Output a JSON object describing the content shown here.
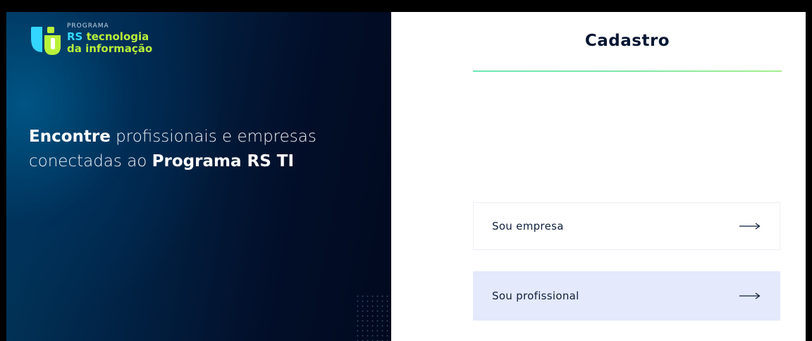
{
  "brand": {
    "program_label": "PROGRAMA",
    "name_rs": "RS",
    "name_line1_rest": " tecnologia",
    "name_line2": "da informação",
    "colors": {
      "cyan": "#33d6ff",
      "lime": "#b9f23a"
    }
  },
  "hero": {
    "part1_strong": "Encontre",
    "part2": " profissionais e empresas conectadas ao ",
    "part3_strong": "Programa RS TI"
  },
  "signup": {
    "title": "Cadastro",
    "options": [
      {
        "label": "Sou empresa",
        "icon": "arrow-right-icon"
      },
      {
        "label": "Sou profissional",
        "icon": "arrow-right-icon"
      }
    ]
  },
  "colors": {
    "title_text": "#061633",
    "accent_line": "#6ee7b7",
    "professional_bg": "#e4e9fb"
  }
}
